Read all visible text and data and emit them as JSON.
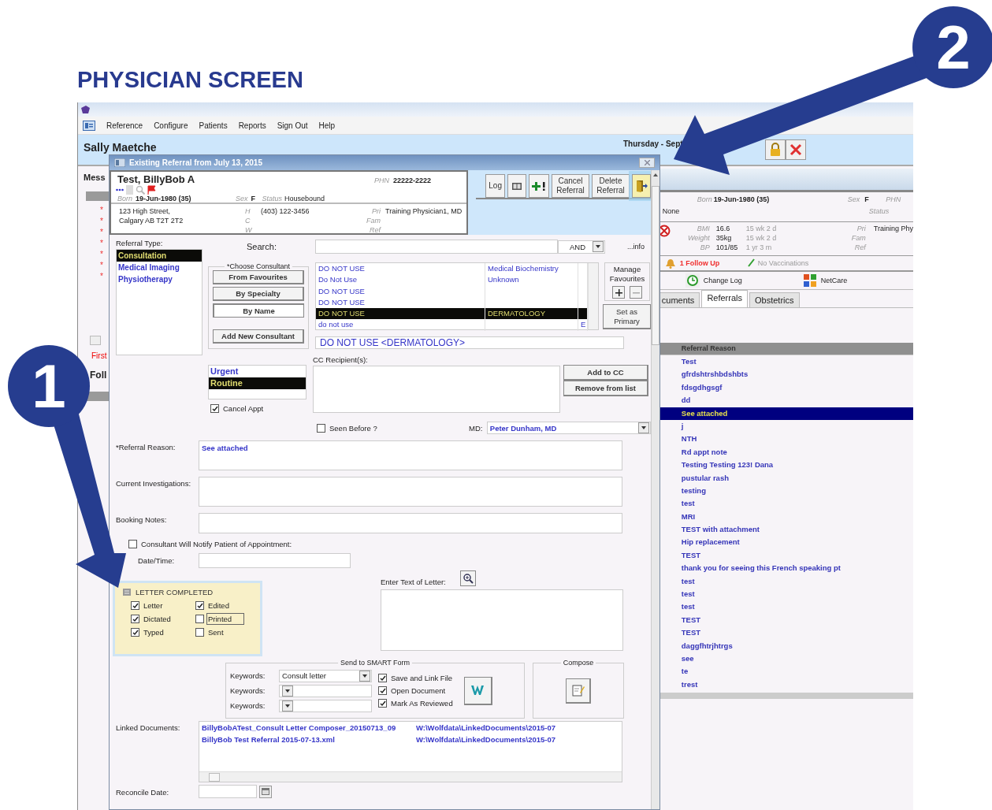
{
  "heading": "PHYSICIAN SCREEN",
  "callouts": [
    {
      "number": "1"
    },
    {
      "number": "2"
    }
  ],
  "menu": [
    "Reference",
    "Configure",
    "Patients",
    "Reports",
    "Sign Out",
    "Help"
  ],
  "app_header": {
    "user": "Sally Maetche",
    "date": "Thursday - Sept"
  },
  "left_panel": {
    "messages": "Mess",
    "markers": [
      "*",
      "*",
      "*",
      "*",
      "*",
      "*",
      "*"
    ],
    "first": "First",
    "follow": "Foll"
  },
  "patient_panel": {
    "born_label": "Born",
    "born": "19-Jun-1980 (35)",
    "sex_label": "Sex",
    "sex": "F",
    "phn_label": "PHN",
    "allergies": "None",
    "status_label": "Status",
    "vitals": [
      {
        "label": "BMI",
        "value": "16.6",
        "age": "15 wk 2 d"
      },
      {
        "label": "Weight",
        "value": "35kg",
        "age": "15 wk 2 d"
      },
      {
        "label": "BP",
        "value": "101/85",
        "age": "1 yr 3 m"
      }
    ],
    "providers": [
      {
        "label": "Pri",
        "value": "Training Phy"
      },
      {
        "label": "Fam"
      },
      {
        "label": "Ref"
      }
    ],
    "follow_up": "1 Follow Up",
    "vaccinations": "No Vaccinations",
    "links": [
      "Change Log",
      "NetCare"
    ],
    "tabs": [
      {
        "label": "cuments",
        "selected": false
      },
      {
        "label": "Referrals",
        "selected": true
      },
      {
        "label": "Obstetrics",
        "selected": false
      }
    ],
    "reasons": {
      "header": "Referral Reason",
      "items": [
        {
          "text": "Test",
          "selected": false
        },
        {
          "text": "gfrdshtrshbdshbts",
          "selected": false
        },
        {
          "text": "fdsgdhgsgf",
          "selected": false
        },
        {
          "text": "dd",
          "selected": false
        },
        {
          "text": "See attached",
          "selected": true
        },
        {
          "text": "j",
          "selected": false
        },
        {
          "text": "NTH",
          "selected": false
        },
        {
          "text": "Rd appt note",
          "selected": false
        },
        {
          "text": "Testing Testing  123!   Dana",
          "selected": false
        },
        {
          "text": "pustular rash",
          "selected": false
        },
        {
          "text": "testing",
          "selected": false
        },
        {
          "text": "test",
          "selected": false
        },
        {
          "text": "MRI",
          "selected": false
        },
        {
          "text": "TEST with attachment",
          "selected": false
        },
        {
          "text": "Hip replacement",
          "selected": false
        },
        {
          "text": "TEST",
          "selected": false
        },
        {
          "text": "thank you for seeing this French speaking pt",
          "selected": false
        },
        {
          "text": "test",
          "selected": false
        },
        {
          "text": "test",
          "selected": false
        },
        {
          "text": "test",
          "selected": false
        },
        {
          "text": "TEST",
          "selected": false
        },
        {
          "text": "TEST",
          "selected": false
        },
        {
          "text": "daggfhtrjhtrgs",
          "selected": false
        },
        {
          "text": "see",
          "selected": false
        },
        {
          "text": "te",
          "selected": false
        },
        {
          "text": "trest",
          "selected": false
        }
      ]
    }
  },
  "dialog": {
    "title": "Existing Referral from July 13, 2015",
    "patient": {
      "name": "Test, BillyBob A",
      "phn_label": "PHN",
      "phn": "22222-2222",
      "born_label": "Born",
      "born": "19-Jun-1980 (35)",
      "sex_label": "Sex",
      "sex": "F",
      "status_label": "Status",
      "status": "Housebound",
      "address": [
        "123 High Street,",
        "Calgary AB  T2T 2T2"
      ],
      "phones": [
        {
          "label": "H",
          "value": "(403) 122-3456"
        },
        {
          "label": "C"
        },
        {
          "label": "W"
        }
      ],
      "providers": [
        {
          "label": "Pri",
          "value": "Training Physician1, MD"
        },
        {
          "label": "Fam"
        },
        {
          "label": "Ref"
        }
      ]
    },
    "toolbar": [
      {
        "kind": "label",
        "label": "Log",
        "highlighted": false
      },
      {
        "kind": "book",
        "highlighted": false
      },
      {
        "kind": "add",
        "highlighted": false
      },
      {
        "kind": "label",
        "label": "Cancel Referral",
        "highlighted": false
      },
      {
        "kind": "label",
        "label": "Delete Referral",
        "highlighted": false
      },
      {
        "kind": "exit",
        "highlighted": true
      }
    ],
    "referral_types": {
      "label": "Referral Type:",
      "items": [
        {
          "text": "Consultation",
          "selected": true
        },
        {
          "text": "Medical Imaging",
          "selected": false
        },
        {
          "text": "Physiotherapy",
          "selected": false
        }
      ]
    },
    "search": {
      "label": "Search:",
      "operator": "AND",
      "info": "...info"
    },
    "choose": {
      "title": "*Choose Consultant",
      "buttons": [
        {
          "label": "From Favourites",
          "selected": false
        },
        {
          "label": "By Specialty",
          "selected": false
        },
        {
          "label": "By Name",
          "selected": true
        }
      ],
      "add": "Add New Consultant"
    },
    "consultants": [
      {
        "name": "DO NOT USE",
        "specialty": "Medical Biochemistry",
        "selected": false
      },
      {
        "name": "Do Not Use",
        "specialty": "Unknown",
        "selected": false
      },
      {
        "name": "DO NOT USE",
        "selected": false
      },
      {
        "name": "DO NOT USE",
        "selected": false
      },
      {
        "name": "DO NOT USE",
        "specialty": "DERMATOLOGY",
        "selected": true
      },
      {
        "name": "do not use",
        "column_3": "E",
        "selected": false
      }
    ],
    "favourites": {
      "title": "Manage Favourites",
      "primary": "Set as Primary"
    },
    "selected_consultant": "DO NOT USE  <DERMATOLOGY>",
    "cc": {
      "label": "CC Recipient(s):",
      "buttons": [
        "Add to CC",
        "Remove from list"
      ]
    },
    "priorities": [
      {
        "text": "Urgent",
        "selected": false
      },
      {
        "text": "Routine",
        "selected": true
      }
    ],
    "cancel_appt": {
      "label": "Cancel Appt",
      "checked": true
    },
    "seen_before": {
      "label": "Seen Before ?",
      "checked": false
    },
    "md": {
      "label": "MD:",
      "value": "Peter  Dunham, MD"
    },
    "fields": [
      {
        "label": "*Referral Reason:",
        "value": "See attached",
        "kind": "tall"
      },
      {
        "label": "Current Investigations:",
        "kind": "tall"
      },
      {
        "label": "Booking Notes:",
        "kind": "short"
      }
    ],
    "notify": {
      "label": "Consultant Will Notify Patient of Appointment:",
      "checked": false
    },
    "date_time": {
      "label": "Date/Time:"
    },
    "letter": {
      "title": "LETTER COMPLETED",
      "highlighted": true,
      "checks": [
        {
          "label": "Letter",
          "checked": true,
          "focused": false
        },
        {
          "label": "Edited",
          "checked": true,
          "focused": false
        },
        {
          "label": "Dictated",
          "checked": true,
          "focused": false
        },
        {
          "label": "Printed",
          "checked": false,
          "focused": true
        },
        {
          "label": "Typed",
          "checked": true,
          "focused": false
        },
        {
          "label": "Sent",
          "checked": false,
          "focused": false
        }
      ]
    },
    "letter_text": {
      "label": "Enter Text of Letter:"
    },
    "smart": {
      "title": "Send to SMART Form",
      "keywords": [
        {
          "label": "Keywords:",
          "value": "Consult letter"
        },
        {
          "label": "Keywords:"
        },
        {
          "label": "Keywords:"
        }
      ],
      "options": [
        {
          "label": "Save and Link File",
          "checked": true
        },
        {
          "label": "Open Document",
          "checked": true
        },
        {
          "label": "Mark As Reviewed",
          "checked": true
        }
      ]
    },
    "compose": {
      "title": "Compose"
    },
    "linked": {
      "label": "Linked Documents:",
      "rows": [
        {
          "name": "BillyBobATest_Consult Letter Composer_20150713_09",
          "path": "W:\\Wolfdata\\LinkedDocuments\\2015-07"
        },
        {
          "name": "BillyBob Test Referral 2015-07-13.xml",
          "path": "W:\\Wolfdata\\LinkedDocuments\\2015-07"
        }
      ]
    },
    "reconcile": {
      "label": "Reconcile Date:"
    }
  }
}
